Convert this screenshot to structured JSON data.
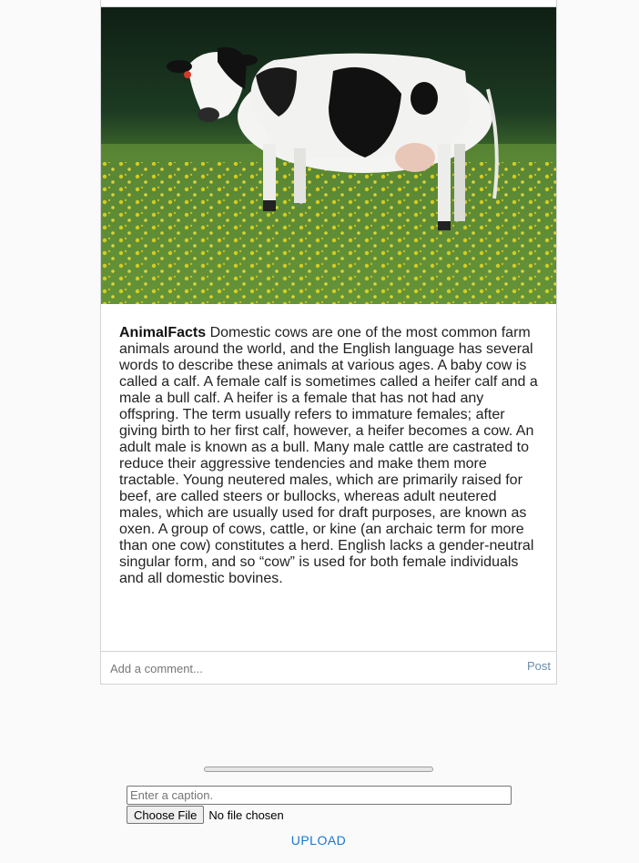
{
  "post": {
    "image_alt": "Holstein cow standing in a field of dandelions",
    "username": "AnimalFacts",
    "caption": "Domestic cows are one of the most common farm animals around the world, and the English language has several words to describe these animals at various ages. A baby cow is called a calf. A female calf is sometimes called a heifer calf and a male a bull calf. A heifer is a female that has not had any offspring. The term usually refers to immature females; after giving birth to her first calf, however, a heifer becomes a cow. An adult male is known as a bull. Many male cattle are castrated to reduce their aggressive tendencies and make them more tractable. Young neutered males, which are primarily raised for beef, are called steers or bullocks, whereas adult neutered males, which are usually used for draft purposes, are known as oxen. A group of cows, cattle, or kine (an archaic term for more than one cow) constitutes a herd. English lacks a gender-neutral singular form, and so “cow” is used for both female individuals and all domestic bovines."
  },
  "comment": {
    "placeholder": "Add a comment...",
    "value": "",
    "post_label": "Post"
  },
  "upload": {
    "progress_percent": 0,
    "caption_placeholder": "Enter a caption.",
    "caption_value": "",
    "choose_file_label": "Choose File",
    "file_status": "No file chosen",
    "upload_label": "UPLOAD"
  },
  "colors": {
    "link_blue": "#1976d2",
    "post_button": "#6a8bab",
    "page_background": "#fafafa",
    "card_border": "#d3d3d3"
  }
}
